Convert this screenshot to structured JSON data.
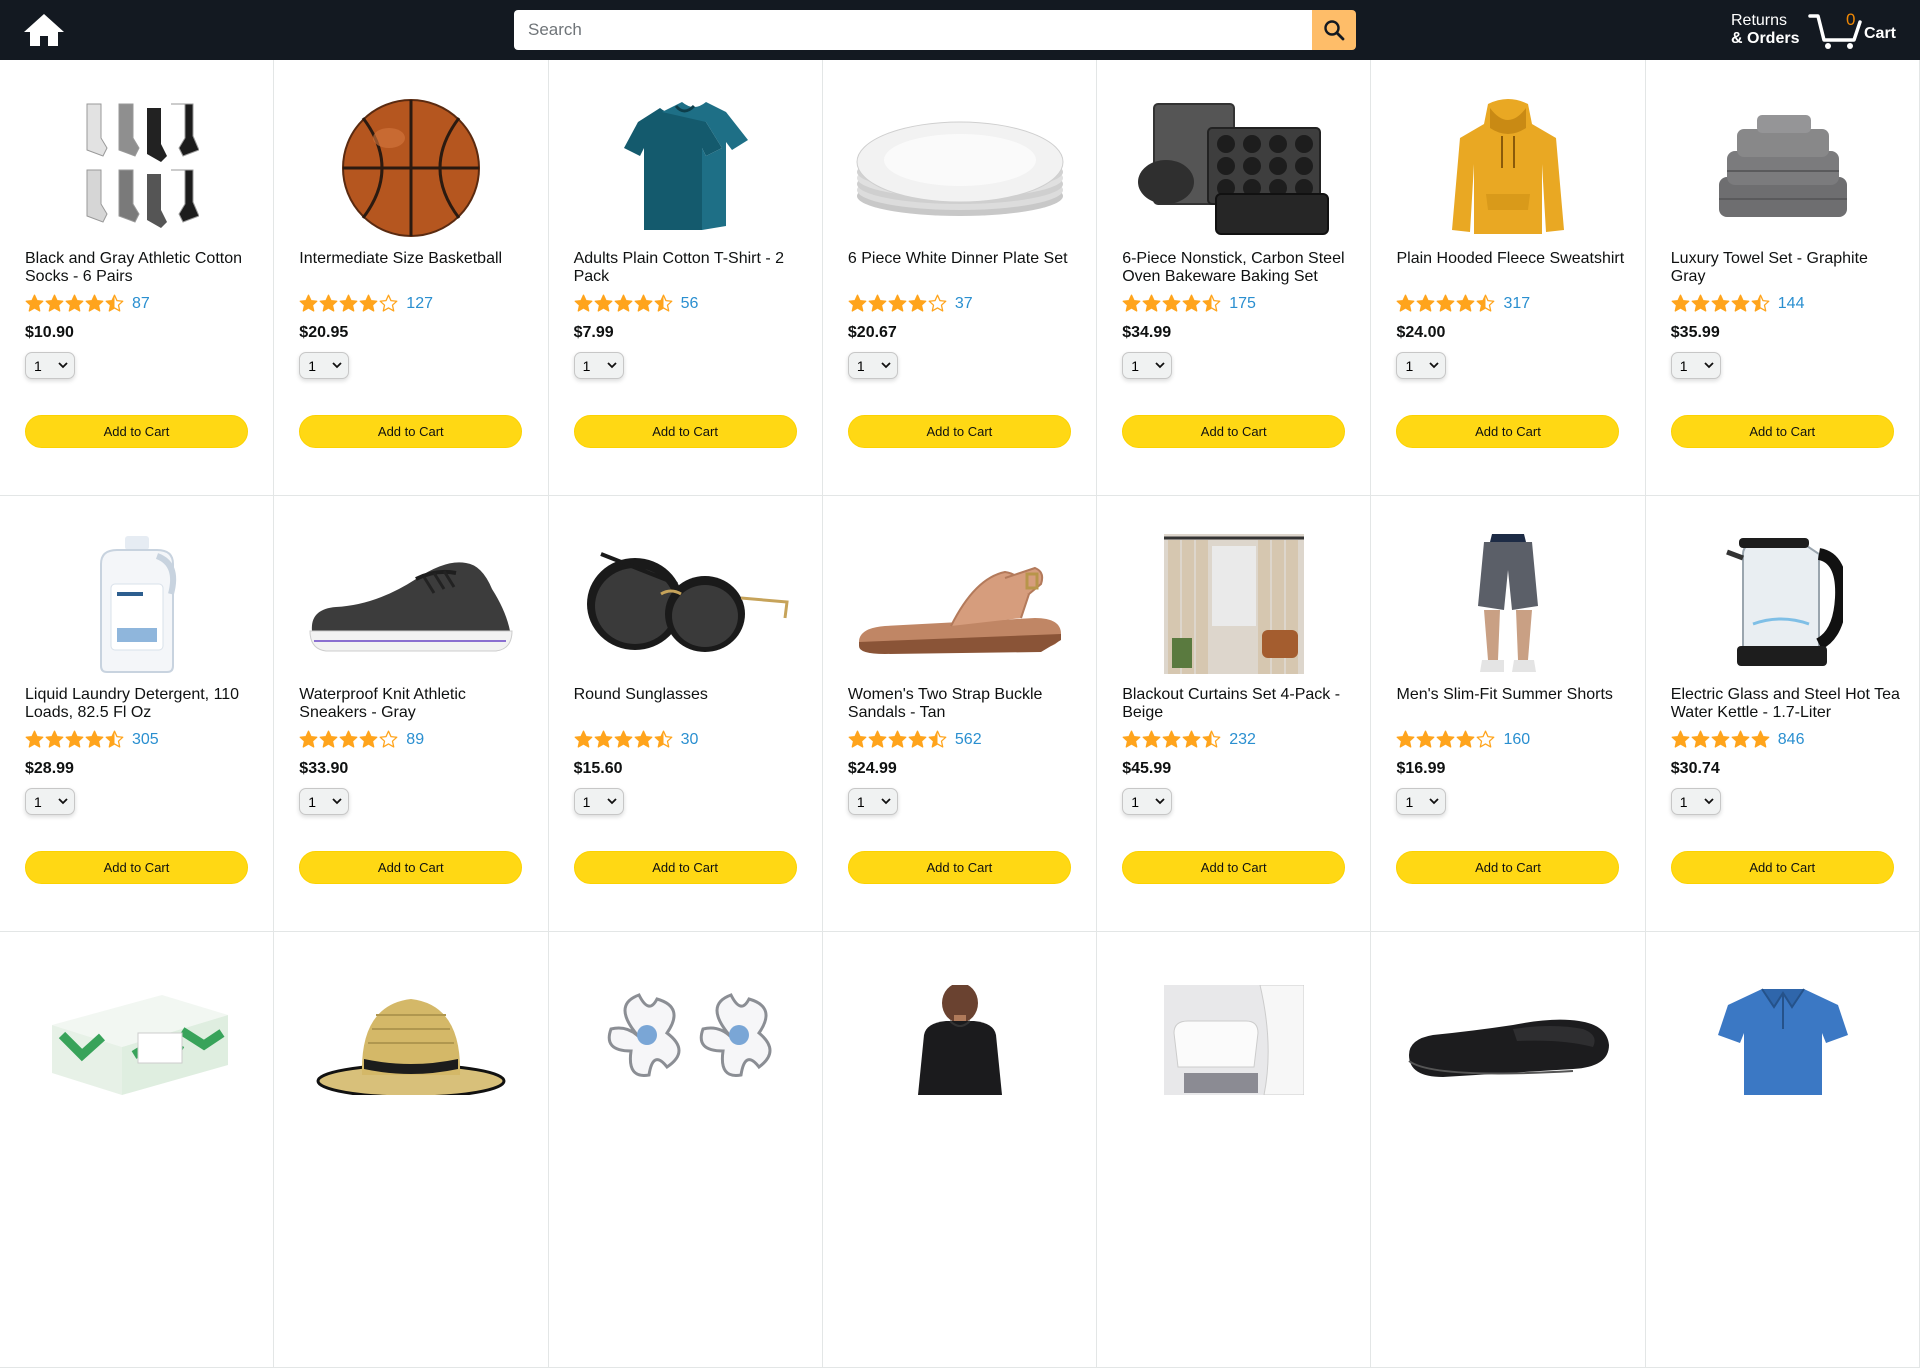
{
  "header": {
    "search_placeholder": "Search",
    "returns_line1": "Returns",
    "returns_line2": "& Orders",
    "cart_count": "0",
    "cart_label": "Cart"
  },
  "colors": {
    "header_bg": "#131921",
    "search_button": "#febd69",
    "add_to_cart": "#ffd814",
    "star": "#ffa41c",
    "rating_link": "#2a8fd0",
    "cart_count": "#f08804"
  },
  "products": [
    {
      "title": "Black and Gray Athletic Cotton Socks - 6 Pairs",
      "rating": 4.5,
      "reviews": "87",
      "price": "$10.90",
      "qty": "1",
      "button": "Add to Cart",
      "image": "socks"
    },
    {
      "title": "Intermediate Size Basketball",
      "rating": 4.0,
      "reviews": "127",
      "price": "$20.95",
      "qty": "1",
      "button": "Add to Cart",
      "image": "basketball"
    },
    {
      "title": "Adults Plain Cotton T-Shirt - 2 Pack",
      "rating": 4.5,
      "reviews": "56",
      "price": "$7.99",
      "qty": "1",
      "button": "Add to Cart",
      "image": "tshirt"
    },
    {
      "title": "6 Piece White Dinner Plate Set",
      "rating": 4.0,
      "reviews": "37",
      "price": "$20.67",
      "qty": "1",
      "button": "Add to Cart",
      "image": "plates"
    },
    {
      "title": "6-Piece Nonstick, Carbon Steel Oven Bakeware Baking Set",
      "rating": 4.5,
      "reviews": "175",
      "price": "$34.99",
      "qty": "1",
      "button": "Add to Cart",
      "image": "bakeware"
    },
    {
      "title": "Plain Hooded Fleece Sweatshirt",
      "rating": 4.5,
      "reviews": "317",
      "price": "$24.00",
      "qty": "1",
      "button": "Add to Cart",
      "image": "hoodie"
    },
    {
      "title": "Luxury Towel Set - Graphite Gray",
      "rating": 4.5,
      "reviews": "144",
      "price": "$35.99",
      "qty": "1",
      "button": "Add to Cart",
      "image": "towels"
    },
    {
      "title": "Liquid Laundry Detergent, 110 Loads, 82.5 Fl Oz",
      "rating": 4.5,
      "reviews": "305",
      "price": "$28.99",
      "qty": "1",
      "button": "Add to Cart",
      "image": "detergent"
    },
    {
      "title": "Waterproof Knit Athletic Sneakers - Gray",
      "rating": 4.0,
      "reviews": "89",
      "price": "$33.90",
      "qty": "1",
      "button": "Add to Cart",
      "image": "sneaker"
    },
    {
      "title": "Round Sunglasses",
      "rating": 4.5,
      "reviews": "30",
      "price": "$15.60",
      "qty": "1",
      "button": "Add to Cart",
      "image": "sunglasses"
    },
    {
      "title": "Women's Two Strap Buckle Sandals - Tan",
      "rating": 4.5,
      "reviews": "562",
      "price": "$24.99",
      "qty": "1",
      "button": "Add to Cart",
      "image": "sandal"
    },
    {
      "title": "Blackout Curtains Set 4-Pack - Beige",
      "rating": 4.5,
      "reviews": "232",
      "price": "$45.99",
      "qty": "1",
      "button": "Add to Cart",
      "image": "curtains"
    },
    {
      "title": "Men's Slim-Fit Summer Shorts",
      "rating": 4.0,
      "reviews": "160",
      "price": "$16.99",
      "qty": "1",
      "button": "Add to Cart",
      "image": "shorts"
    },
    {
      "title": "Electric Glass and Steel Hot Tea Water Kettle - 1.7-Liter",
      "rating": 5.0,
      "reviews": "846",
      "price": "$30.74",
      "qty": "1",
      "button": "Add to Cart",
      "image": "kettle"
    },
    {
      "title": "",
      "rating": null,
      "reviews": "",
      "price": "",
      "qty": "",
      "button": "",
      "image": "tissues"
    },
    {
      "title": "",
      "rating": null,
      "reviews": "",
      "price": "",
      "qty": "",
      "button": "",
      "image": "straw-hat"
    },
    {
      "title": "",
      "rating": null,
      "reviews": "",
      "price": "",
      "qty": "",
      "button": "",
      "image": "earrings"
    },
    {
      "title": "",
      "rating": null,
      "reviews": "",
      "price": "",
      "qty": "",
      "button": "",
      "image": "sweater"
    },
    {
      "title": "",
      "rating": null,
      "reviews": "",
      "price": "",
      "qty": "",
      "button": "",
      "image": "bath-mat"
    },
    {
      "title": "",
      "rating": null,
      "reviews": "",
      "price": "",
      "qty": "",
      "button": "",
      "image": "flats"
    },
    {
      "title": "",
      "rating": null,
      "reviews": "",
      "price": "",
      "qty": "",
      "button": "",
      "image": "polo"
    }
  ]
}
